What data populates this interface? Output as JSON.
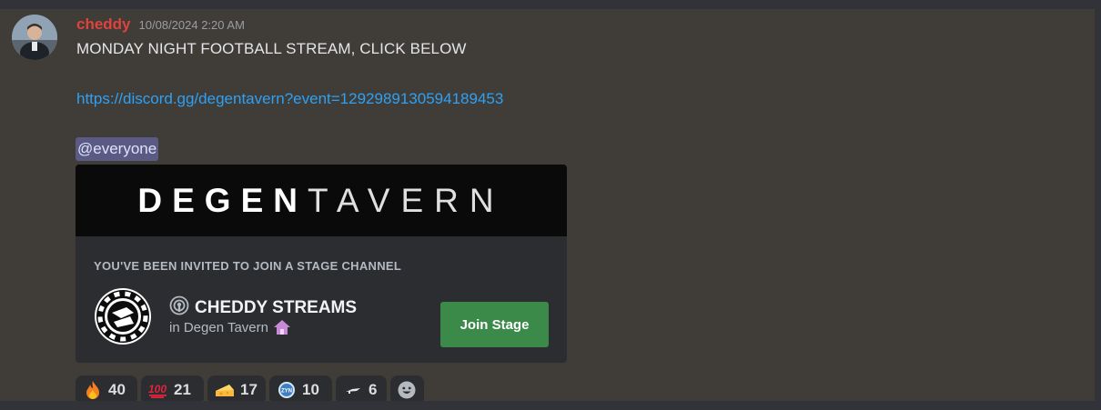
{
  "message": {
    "username": "cheddy",
    "timestamp": "10/08/2024 2:20 AM",
    "line1": "MONDAY NIGHT FOOTBALL STREAM, CLICK BELOW",
    "link": "https://discord.gg/degentavern?event=1292989130594189453",
    "mention": "@everyone",
    "username_color": "#e0423c",
    "link_color": "#2fa0f3"
  },
  "invite": {
    "banner_bold": "DEGEN",
    "banner_light": "TAVERN",
    "title": "YOU'VE BEEN INVITED TO JOIN A STAGE CHANNEL",
    "stage_name": "CHEDDY STREAMS",
    "in_server": "in Degen Tavern",
    "join_label": "Join Stage",
    "join_color": "#3c8a4a"
  },
  "reactions": [
    {
      "icon": "fire-emoji",
      "count": "40"
    },
    {
      "icon": "hundred-emoji",
      "count": "21"
    },
    {
      "icon": "cheese-emoji",
      "count": "17"
    },
    {
      "icon": "zyn-emoji",
      "count": "10"
    },
    {
      "icon": "custom-emoji",
      "count": "6"
    },
    {
      "icon": "add-reaction-icon",
      "count": ""
    }
  ]
}
